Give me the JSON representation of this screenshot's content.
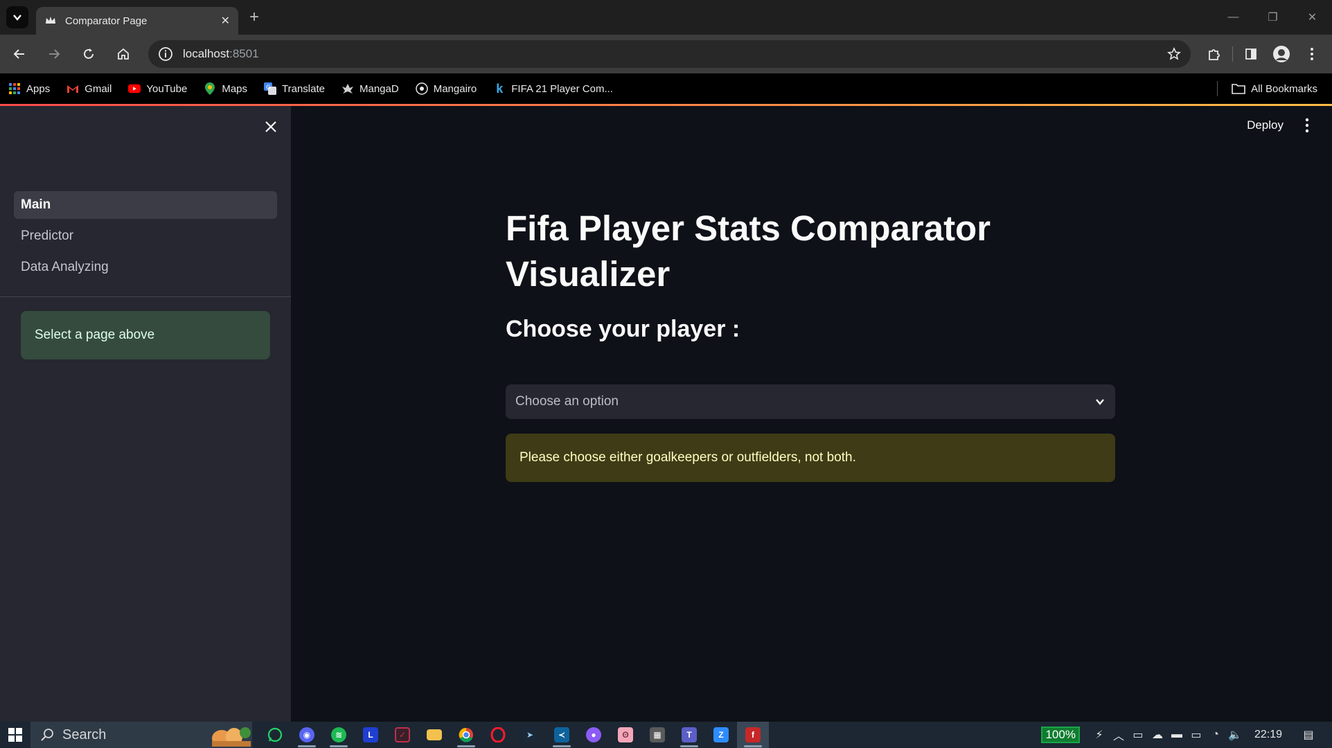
{
  "browser": {
    "tab_title": "Comparator Page",
    "new_tab_glyph": "+",
    "close_tab_glyph": "✕",
    "url_host": "localhost",
    "url_port": ":8501",
    "window_controls": [
      "—",
      "❐",
      "✕"
    ]
  },
  "bookmarks": {
    "items": [
      {
        "label": "Apps",
        "icon": "apps-grid-icon"
      },
      {
        "label": "Gmail",
        "icon": "gmail-icon"
      },
      {
        "label": "YouTube",
        "icon": "youtube-icon"
      },
      {
        "label": "Maps",
        "icon": "maps-pin-icon"
      },
      {
        "label": "Translate",
        "icon": "translate-icon"
      },
      {
        "label": "MangaD",
        "icon": "manga-icon"
      },
      {
        "label": "Mangairo",
        "icon": "mangairo-icon"
      },
      {
        "label": "FIFA 21 Player Com...",
        "icon": "k-icon"
      }
    ],
    "all_bookmarks": "All Bookmarks"
  },
  "sidebar": {
    "nav": [
      {
        "label": "Main",
        "active": true
      },
      {
        "label": "Predictor",
        "active": false
      },
      {
        "label": "Data Analyzing",
        "active": false
      }
    ],
    "info_message": "Select a page above"
  },
  "header": {
    "deploy_label": "Deploy"
  },
  "main": {
    "title": "Fifa Player Stats Comparator Visualizer",
    "subheader": "Choose your player :",
    "select_placeholder": "Choose an option",
    "warning": "Please choose either goalkeepers or outfielders, not both."
  },
  "taskbar": {
    "search_label": "Search",
    "battery": "100%",
    "time": "22:19"
  },
  "colors": {
    "app_bg": "#0e1117",
    "sidebar_bg": "#262730",
    "info_bg": "#344b3e",
    "warning_bg": "#3e3b16",
    "accent": "#ff4b4b"
  }
}
